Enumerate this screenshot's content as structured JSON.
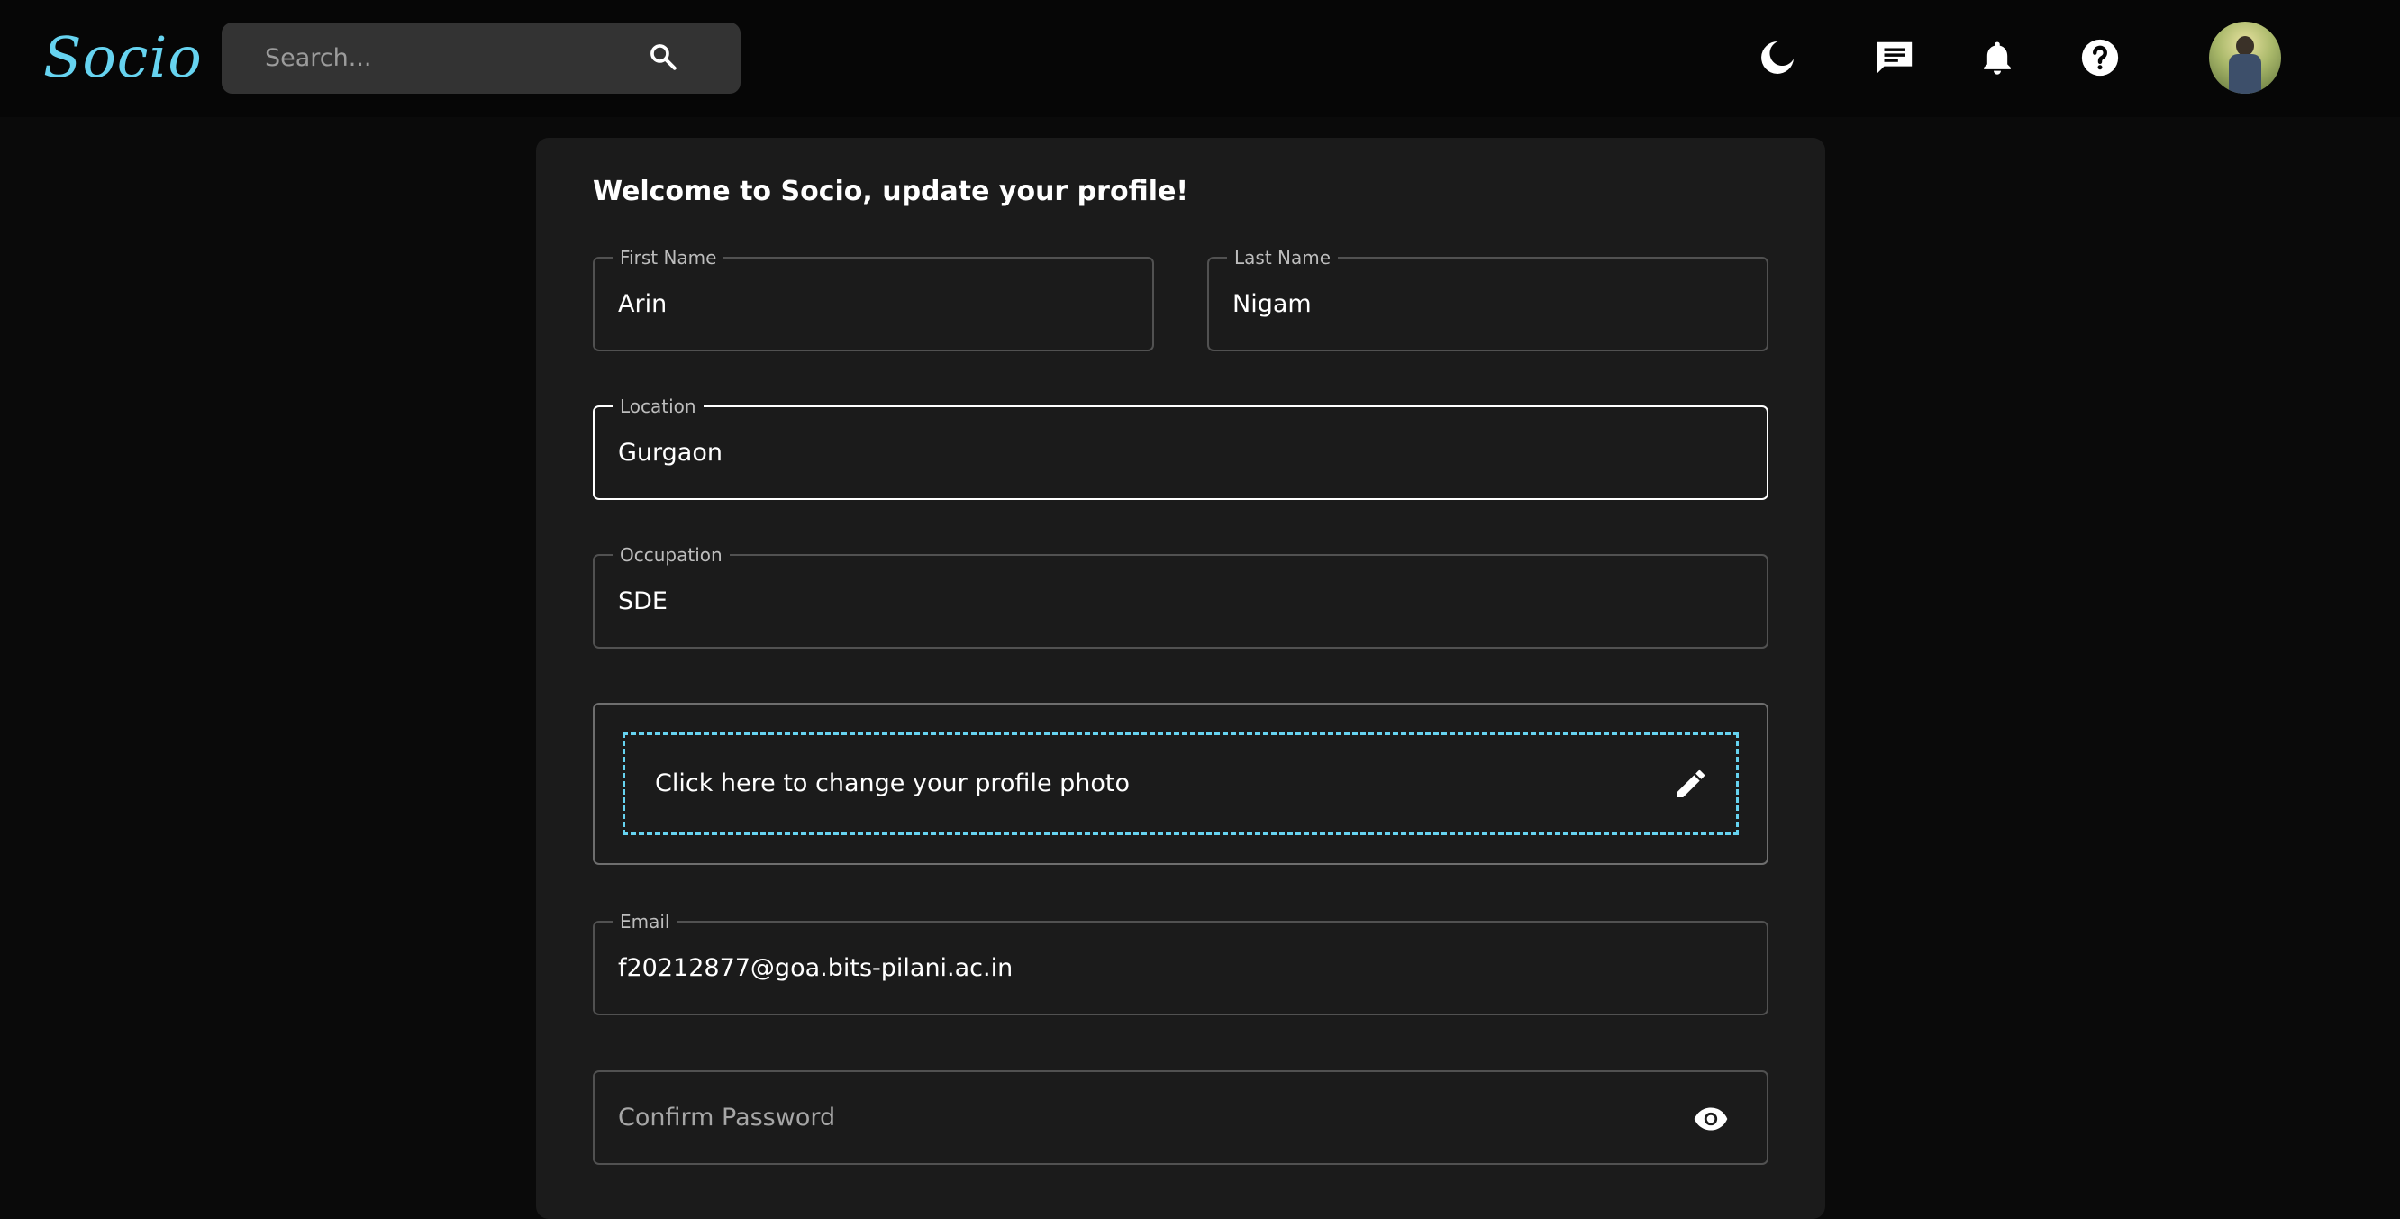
{
  "app": {
    "logo": "Socio"
  },
  "navbar": {
    "search": {
      "placeholder": "Search..."
    },
    "icons": [
      "search-icon",
      "dark-mode-moon-icon",
      "message-icon",
      "notifications-bell-icon",
      "help-icon"
    ]
  },
  "form": {
    "title": "Welcome to Socio, update your profile!",
    "first_name": {
      "label": "First Name",
      "value": "Arin"
    },
    "last_name": {
      "label": "Last Name",
      "value": "Nigam"
    },
    "location": {
      "label": "Location",
      "value": "Gurgaon"
    },
    "occupation": {
      "label": "Occupation",
      "value": "SDE"
    },
    "photo": {
      "prompt": "Click here to change your profile photo"
    },
    "email": {
      "label": "Email",
      "value": "f20212877@goa.bits-pilani.ac.in"
    },
    "confirm_password": {
      "placeholder": "Confirm Password"
    }
  },
  "colors": {
    "accent": "#66d3f0",
    "background": "#0a0a0a",
    "card": "#1b1b1b",
    "search_bg": "#333333"
  }
}
